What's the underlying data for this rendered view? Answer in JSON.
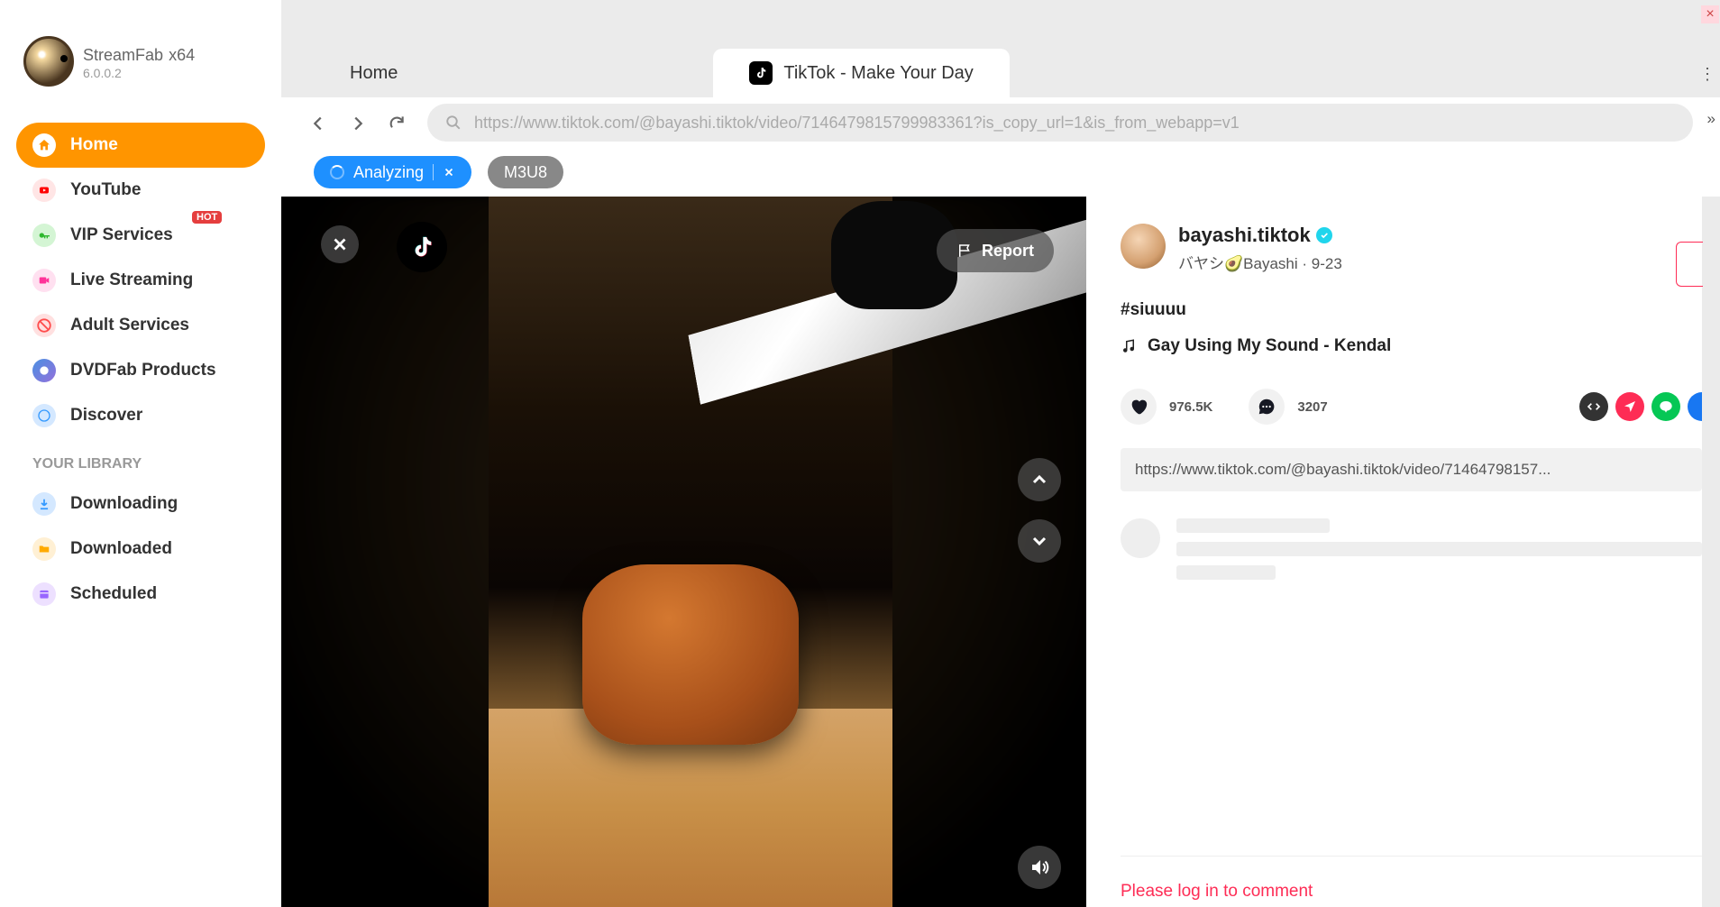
{
  "app": {
    "name": "StreamFab",
    "arch": "x64",
    "version": "6.0.0.2"
  },
  "sidebar": {
    "items": [
      {
        "label": "Home"
      },
      {
        "label": "YouTube"
      },
      {
        "label": "VIP Services",
        "hot": "HOT"
      },
      {
        "label": "Live Streaming"
      },
      {
        "label": "Adult Services"
      },
      {
        "label": "DVDFab Products"
      },
      {
        "label": "Discover"
      }
    ],
    "library_header": "YOUR LIBRARY",
    "library": [
      {
        "label": "Downloading"
      },
      {
        "label": "Downloaded"
      },
      {
        "label": "Scheduled"
      }
    ]
  },
  "tabs": {
    "home": "Home",
    "active": "TikTok - Make Your Day"
  },
  "address": "https://www.tiktok.com/@bayashi.tiktok/video/7146479815799983361?is_copy_url=1&is_from_webapp=v1",
  "chips": {
    "analyzing": "Analyzing",
    "m3u8": "M3U8"
  },
  "video": {
    "report": "Report"
  },
  "post": {
    "username": "bayashi.tiktok",
    "displayname": "バヤシ🥑Bayashi",
    "date": "9-23",
    "caption": "#siuuuu",
    "music": "Gay Using My Sound - Kendal",
    "likes": "976.5K",
    "comments": "3207",
    "share_link": "https://www.tiktok.com/@bayashi.tiktok/video/71464798157...",
    "login_prompt": "Please log in to comment"
  }
}
